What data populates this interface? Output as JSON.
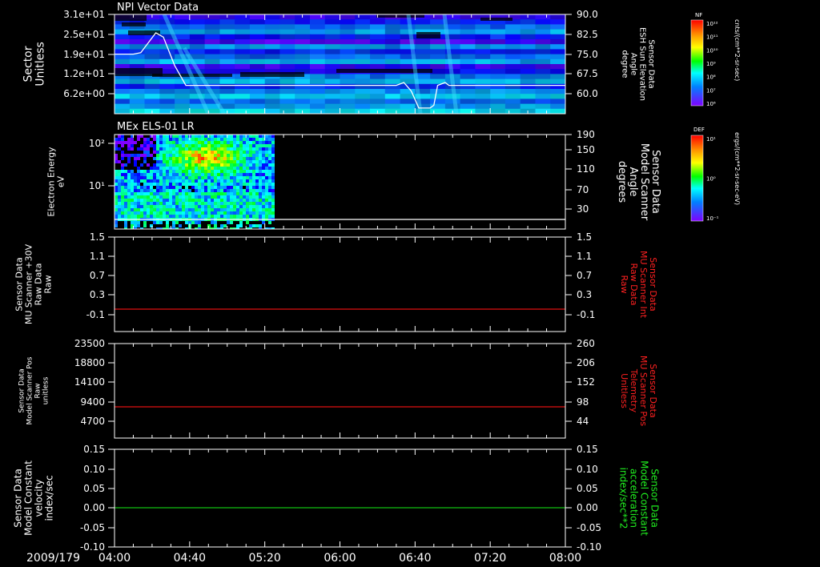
{
  "date_label": "2009/179",
  "x_axis": {
    "ticks": [
      "04:00",
      "04:40",
      "05:20",
      "06:00",
      "06:40",
      "07:20",
      "08:00"
    ],
    "start_min": 240,
    "end_min": 480
  },
  "colorbars": [
    {
      "tag": "NF",
      "unit_label": "cnts/(cm**2-sr-sec)",
      "tick_labels": [
        "10¹²",
        "10¹¹",
        "10¹⁰",
        "10⁹",
        "10⁸",
        "10⁷",
        "10⁶"
      ]
    },
    {
      "tag": "DEF",
      "unit_label": "ergs/(cm**2-sr-sec-eV)",
      "tick_labels": [
        "10¹",
        "10⁰",
        "10⁻¹"
      ]
    }
  ],
  "panels": {
    "p1": {
      "title": "NPI Vector Data",
      "left_label": [
        "Sector",
        "Unitless"
      ],
      "right_label": [
        "Sensor Data",
        "ESH Sun Elevation",
        "Angle",
        "degree"
      ],
      "left_ticks": [
        "3.1e+01",
        "2.5e+01",
        "1.9e+01",
        "1.2e+01",
        "6.2e+00"
      ],
      "right_ticks": [
        "90.0",
        "82.5",
        "75.0",
        "67.5",
        "60.0"
      ]
    },
    "p2": {
      "title": "MEx ELS-01 LR",
      "left_label": [
        "Electron Energy",
        "eV"
      ],
      "right_label": [
        "Sensor Data",
        "Model Scanner",
        "Angle",
        "degrees"
      ],
      "left_ticks": [
        "10²",
        "10¹"
      ],
      "right_ticks": [
        "190",
        "150",
        "110",
        "70",
        "30"
      ]
    },
    "p3": {
      "left_label": [
        "Sensor Data",
        "MU Scanner +30V",
        "Raw Data",
        "Raw"
      ],
      "right_label": [
        "Sensor Data",
        "MU Scanner Int",
        "Raw Data",
        "Raw"
      ],
      "left_ticks": [
        "1.5",
        "1.1",
        "0.7",
        "0.3",
        "-0.1"
      ],
      "right_ticks": [
        "1.5",
        "1.1",
        "0.7",
        "0.3",
        "-0.1"
      ]
    },
    "p4": {
      "left_label": [
        "Sensor Data",
        "Model Scanner Pos",
        "Raw",
        "unitless"
      ],
      "right_label": [
        "Sensor Data",
        "MU Scanner Pos",
        "Telemetry",
        "Unitless"
      ],
      "left_ticks": [
        "23500",
        "18800",
        "14100",
        "9400",
        "4700"
      ],
      "right_ticks": [
        "260",
        "206",
        "152",
        "98",
        "44"
      ]
    },
    "p5": {
      "left_label": [
        "Sensor Data",
        "Model Constant",
        "velocity",
        "index/sec"
      ],
      "right_label": [
        "Sensor Data",
        "Model Constant",
        "acceleration",
        "index/sec**2"
      ],
      "left_ticks": [
        "0.15",
        "0.10",
        "0.05",
        "0.00",
        "-0.05",
        "-0.10"
      ],
      "right_ticks": [
        "0.15",
        "0.10",
        "0.05",
        "0.00",
        "-0.05",
        "-0.10"
      ]
    }
  },
  "colors": {
    "label_red": "#ff2020",
    "label_green": "#20ee20",
    "trace_red": "#e01010",
    "trace_green": "#10c010"
  },
  "chart_data": [
    {
      "type": "heatmap",
      "title": "NPI Vector Data",
      "ylabel": "Sector Unitless",
      "y2label": "Sensor Data ESH Sun Elevation Angle degree",
      "ylim": [
        0,
        31
      ],
      "y2lim": [
        55,
        90
      ],
      "overlay_series": {
        "name": "ESH Sun Elevation Angle",
        "x": [
          "04:00",
          "04:10",
          "04:14",
          "04:18",
          "04:22",
          "04:26",
          "04:32",
          "04:38",
          "06:30",
          "06:34",
          "06:38",
          "06:42",
          "06:46",
          "06:48",
          "06:50",
          "06:52",
          "06:56",
          "06:58"
        ],
        "y": [
          76,
          76,
          76.5,
          80,
          83.5,
          82,
          72,
          65,
          65,
          66,
          63,
          57,
          57,
          57,
          58,
          65,
          66,
          65
        ]
      }
    },
    {
      "type": "heatmap",
      "title": "MEx ELS-01 LR",
      "ylabel": "Electron Energy eV",
      "y2label": "Sensor Data Model Scanner Angle degrees",
      "log_y": true,
      "data_extent_x": [
        "04:00",
        "05:24"
      ],
      "y2lim": [
        10,
        190
      ],
      "overlay_series": {
        "name": "Model Scanner Angle",
        "x": [
          "04:00",
          "08:00"
        ],
        "y": [
          10,
          10
        ]
      }
    },
    {
      "type": "line",
      "ylim": [
        -0.3,
        1.5
      ],
      "series": [
        {
          "name": "",
          "x": [
            "04:00",
            "08:00"
          ],
          "y": [
            0.0,
            0.0
          ]
        }
      ]
    },
    {
      "type": "line",
      "ylim": [
        0,
        23500
      ],
      "series": [
        {
          "name": "",
          "x": [
            "04:00",
            "08:00"
          ],
          "y": [
            7500,
            7500
          ]
        }
      ]
    },
    {
      "type": "line",
      "ylim": [
        -0.1,
        0.15
      ],
      "series": [
        {
          "name": "",
          "x": [
            "04:00",
            "08:00"
          ],
          "y": [
            0.0,
            0.0
          ]
        }
      ]
    }
  ]
}
